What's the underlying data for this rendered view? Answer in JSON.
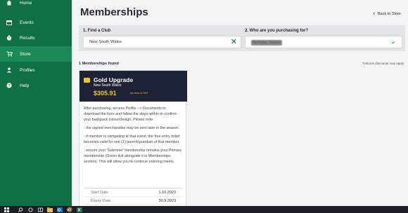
{
  "sidebar": {
    "items": [
      {
        "label": "Home",
        "icon": "home-icon"
      },
      {
        "label": "Events",
        "icon": "calendar-icon"
      },
      {
        "label": "Results",
        "icon": "stopwatch-icon"
      },
      {
        "label": "Store",
        "icon": "cart-icon"
      },
      {
        "label": "Profiles",
        "icon": "person-icon"
      },
      {
        "label": "Help",
        "icon": "help-icon"
      }
    ],
    "active": "Store",
    "colors": {
      "bg": "#0f6f45",
      "active": "#1b8a58"
    }
  },
  "header": {
    "title": "Memberships",
    "back_label": "Back to Store"
  },
  "filters": {
    "club_label": "1. Find a Club",
    "club_value": "New South Wales",
    "who_label": "2. Who are you purchasing for?",
    "who_value": "Nicholas Gladen"
  },
  "results": {
    "count_label": "1 Memberships found",
    "volume_note": "*Volume discounts may apply"
  },
  "card": {
    "title": "Gold Upgrade",
    "subtitle": "New South Wales",
    "price": "$305.91",
    "price_note": "Inc fees & GST",
    "paragraphs": [
      "After purchasing, access Profile --> Documents to download the form and follow the steps within to confirm your backpack colour/design. Please note:",
      "- the signed merchandise may be sent later in the season.",
      "- if member is competing at that event, the free entry ticket becomes valid for one (1) parent/guardian of that member.",
      "- ensure your 'Swimmer' membership remains your Primary membership (Green tick alongside it in Memberships section). This will allow you to continue entering meets."
    ],
    "dates": [
      {
        "label": "Start Date",
        "value": "1.10.2022"
      },
      {
        "label": "Expiry Date",
        "value": "30.9.2023"
      }
    ]
  },
  "taskbar": {
    "icons": [
      "windows-start-icon",
      "search-icon",
      "task-view-icon",
      "widgets-icon",
      "file-explorer-icon",
      "outlook-icon",
      "chrome-icon",
      "excel-icon"
    ]
  },
  "colors": {
    "accent": "#0f6f45",
    "card_header": "#1e2236",
    "gold": "#f0c419"
  }
}
